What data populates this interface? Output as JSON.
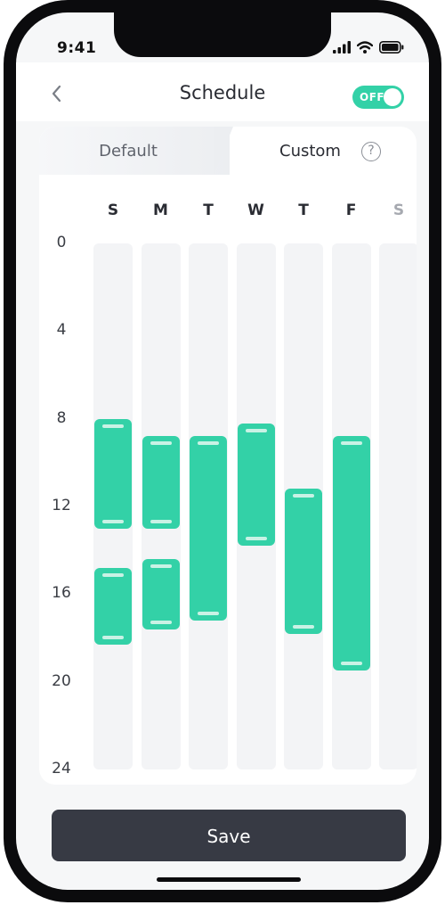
{
  "status_bar": {
    "time": "9:41",
    "icons": [
      "signal-icon",
      "wifi-icon",
      "battery-icon"
    ]
  },
  "header": {
    "title": "Schedule",
    "back_icon": "chevron-left-icon",
    "toggle_label": "OFF",
    "toggle_color": "#33d1a7"
  },
  "tabs": {
    "default_label": "Default",
    "custom_label": "Custom",
    "help_glyph": "?",
    "selected": "Custom"
  },
  "schedule": {
    "hour_labels": [
      "0",
      "4",
      "8",
      "12",
      "16",
      "20",
      "24"
    ],
    "days": [
      {
        "label": "S",
        "enabled": true,
        "blocks": [
          {
            "start": 8.0,
            "end": 13.0
          },
          {
            "start": 14.8,
            "end": 18.3
          }
        ]
      },
      {
        "label": "M",
        "enabled": true,
        "blocks": [
          {
            "start": 8.8,
            "end": 13.0
          },
          {
            "start": 14.4,
            "end": 17.6
          }
        ]
      },
      {
        "label": "T",
        "enabled": true,
        "blocks": [
          {
            "start": 8.8,
            "end": 17.2
          }
        ]
      },
      {
        "label": "W",
        "enabled": true,
        "blocks": [
          {
            "start": 8.2,
            "end": 13.8
          }
        ]
      },
      {
        "label": "T",
        "enabled": true,
        "blocks": [
          {
            "start": 11.2,
            "end": 17.8
          }
        ]
      },
      {
        "label": "F",
        "enabled": true,
        "blocks": [
          {
            "start": 8.8,
            "end": 19.5
          }
        ]
      },
      {
        "label": "S",
        "enabled": false,
        "blocks": []
      }
    ],
    "block_color": "#33d1a7"
  },
  "footer": {
    "save_label": "Save"
  }
}
